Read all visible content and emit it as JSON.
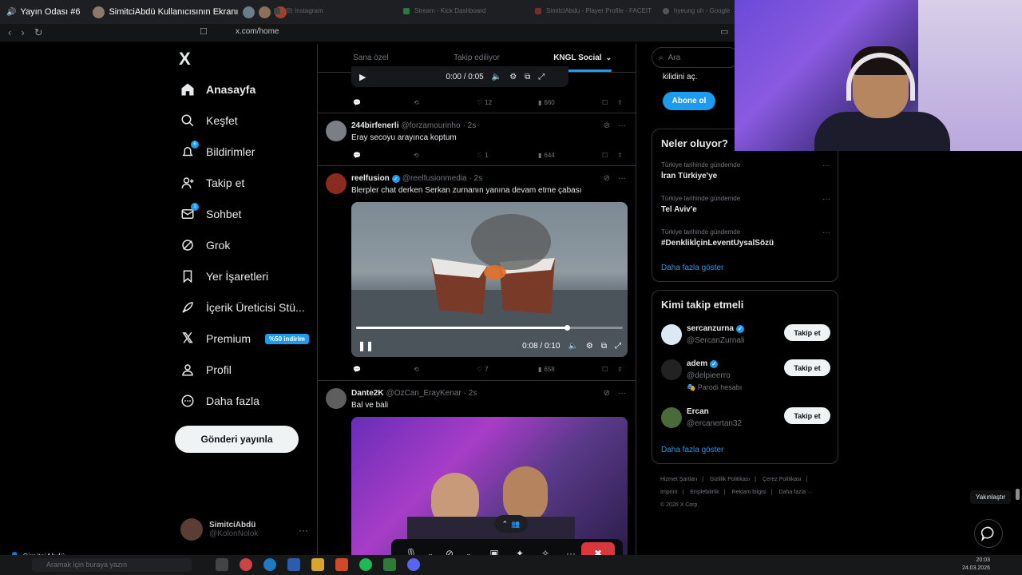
{
  "topbar": {
    "room_title": "Yayın Odası #6",
    "screen_share_label": "SimitciAbdü Kullanıcısının Ekranı",
    "bg_tabs": [
      "(8) Instagram",
      "Stream - Kick Dashboard",
      "SimitciAbdu - Player Profile - FACEIT",
      "hyeung oh - Google"
    ]
  },
  "browser": {
    "url": "x.com/home"
  },
  "leftnav": {
    "logo": "X",
    "items": [
      {
        "label": "Anasayfa",
        "icon": "home-icon"
      },
      {
        "label": "Keşfet",
        "icon": "search-icon"
      },
      {
        "label": "Bildirimler",
        "icon": "bell-icon",
        "badge": "6"
      },
      {
        "label": "Takip et",
        "icon": "add-user-icon"
      },
      {
        "label": "Sohbet",
        "icon": "mail-icon",
        "badge": "1"
      },
      {
        "label": "Grok",
        "icon": "grok-icon"
      },
      {
        "label": "Yer İşaretleri",
        "icon": "bookmark-icon"
      },
      {
        "label": "İçerik Üreticisi Stü...",
        "icon": "rocket-icon"
      },
      {
        "label": "Premium",
        "icon": "x-icon",
        "chip": "%50 indirim"
      },
      {
        "label": "Profil",
        "icon": "user-icon"
      },
      {
        "label": "Daha fazla",
        "icon": "more-circle-icon"
      }
    ],
    "post_button": "Gönderi yayınla",
    "account": {
      "name": "SimitciAbdü",
      "handle": "@KolonNolok",
      "more": "···"
    }
  },
  "feed": {
    "tabs": [
      {
        "label": "Sana özel",
        "active": false
      },
      {
        "label": "Takip ediliyor",
        "active": false
      },
      {
        "label": "KNGL Social",
        "active": true
      }
    ],
    "audio_player": {
      "time": "0:00 / 0:05"
    },
    "first_actions": {
      "likes": "12",
      "views": "660"
    },
    "tweets": [
      {
        "name": "244birfenerli",
        "handle": "@forzamourinho",
        "time": "· 2s",
        "text": "Eray secoyu arayınca koptum",
        "likes": "1",
        "views": "644"
      },
      {
        "name": "reelfusion",
        "handle": "@reelfusionmedia",
        "time": "· 2s",
        "text": "Blerpler chat derken Serkan zurnanın yanına devam etme çabası",
        "video_time": "0:08 / 0:10",
        "video_progress": 0.79,
        "likes": "7",
        "views": "658"
      },
      {
        "name": "Dante2K",
        "handle": "@OzCan_ErayKenar",
        "time": "· 2s",
        "text": "Bal ve bali"
      }
    ]
  },
  "right": {
    "search_placeholder": "Ara",
    "premium_text": "kilidini aç.",
    "subscribe_button": "Abone ol",
    "trends_title": "Neler oluyor?",
    "trends": [
      {
        "context": "Türkiye tarihinde gündemde",
        "topic": "İran Türkiye'ye"
      },
      {
        "context": "Türkiye tarihinde gündemde",
        "topic": "Tel Aviv'e"
      },
      {
        "context": "Türkiye tarihinde gündemde",
        "topic": "#DenklikİçinLeventUysalSözü"
      }
    ],
    "show_more": "Daha fazla göster",
    "who_title": "Kimi takip etmeli",
    "follow_button": "Takip et",
    "suggestions": [
      {
        "name": "sercanzurna",
        "handle": "@SercanZurnali",
        "extra": ""
      },
      {
        "name": "adem",
        "handle": "@delpieerro",
        "extra": "🎭 Parodi hesabı"
      },
      {
        "name": "Ercan",
        "handle": "@ercanertan32",
        "extra": ""
      }
    ],
    "footer": [
      "Hizmet Şartları",
      "|",
      "Gizlilik Politikası",
      "|",
      "Çerez Politikası",
      "|",
      "Imprint",
      "|",
      "Erişilebilirlik",
      "|",
      "Reklam bilgisi",
      "|",
      "Daha fazla ···",
      "© 2026 X Corp."
    ]
  },
  "overlay": {
    "zoom_tooltip": "Yakınlaştır",
    "user_tag": "SimitciAbdü"
  },
  "taskbar": {
    "search_placeholder": "Aramak için buraya yazın",
    "time": "20:03",
    "date": "24.03.2026"
  },
  "colors": {
    "accent": "#1d9bf0",
    "end_call": "#da373c",
    "background": "#000000"
  }
}
